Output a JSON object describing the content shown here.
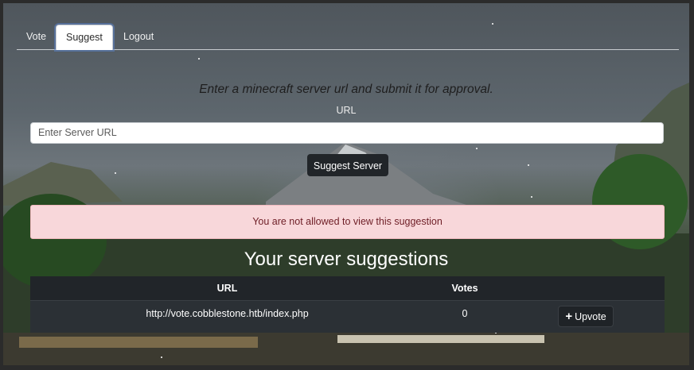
{
  "tabs": [
    {
      "label": "Vote",
      "active": false
    },
    {
      "label": "Suggest",
      "active": true
    },
    {
      "label": "Logout",
      "active": false
    }
  ],
  "form": {
    "intro": "Enter a minecraft server url and submit it for approval.",
    "url_label": "URL",
    "url_placeholder": "Enter Server URL",
    "url_value": "",
    "submit_label": "Suggest Server"
  },
  "alert": {
    "message": "You are not allowed to view this suggestion",
    "color": "#f8d7da"
  },
  "suggestions": {
    "heading": "Your server suggestions",
    "columns": [
      "URL",
      "Votes",
      ""
    ],
    "rows": [
      {
        "url": "http://vote.cobblestone.htb/index.php",
        "votes": "0",
        "action_label": "Upvote",
        "action_icon": "plus-icon"
      }
    ]
  }
}
